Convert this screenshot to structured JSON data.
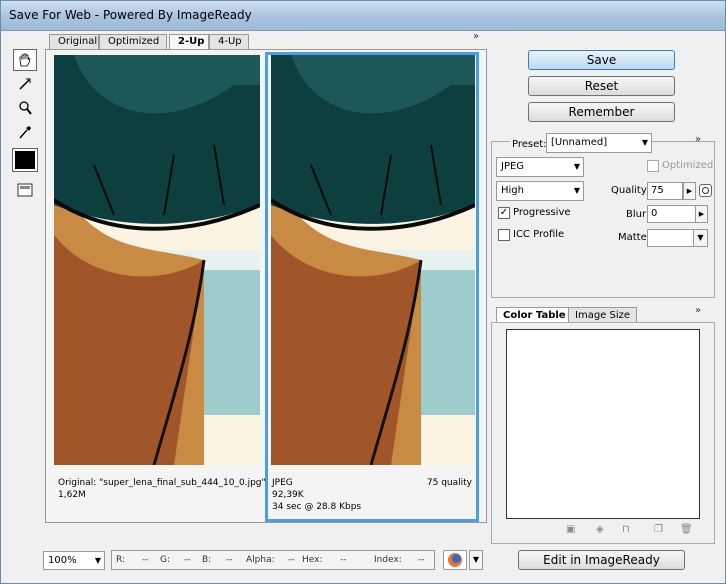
{
  "window": {
    "title": "Save For Web - Powered By ImageReady"
  },
  "tabs": [
    {
      "label": "Original"
    },
    {
      "label": "Optimized"
    },
    {
      "label": "2-Up"
    },
    {
      "label": "4-Up"
    }
  ],
  "original_pane": {
    "caption": "Original: \"super_lena_final_sub_444_10_0.jpg\"",
    "size": "1,62M"
  },
  "optimized_pane": {
    "format": "JPEG",
    "size": "92,39K",
    "download": "34 sec @ 28.8 Kbps",
    "quality": "75 quality"
  },
  "buttons": {
    "save": "Save",
    "reset": "Reset",
    "remember": "Remember",
    "edit": "Edit in ImageReady"
  },
  "settings": {
    "preset_label": "Preset:",
    "preset_value": "[Unnamed]",
    "format": "JPEG",
    "optimized_label": "Optimized",
    "quality_level": "High",
    "quality_label": "Quality:",
    "quality_value": "75",
    "progressive_label": "Progressive",
    "blur_label": "Blur:",
    "blur_value": "0",
    "icc_label": "ICC Profile",
    "matte_label": "Matte:"
  },
  "color_tabs": [
    {
      "label": "Color Table"
    },
    {
      "label": "Image Size"
    }
  ],
  "status_bar": {
    "zoom": "100%",
    "r": "R:",
    "r_val": "--",
    "g": "G:",
    "g_val": "--",
    "b": "B:",
    "b_val": "--",
    "alpha": "Alpha:",
    "alpha_val": "--",
    "hex": "Hex:",
    "hex_val": "--",
    "index": "Index:",
    "index_val": "--"
  },
  "icons": [
    "hand-icon",
    "slice-select-icon",
    "zoom-icon",
    "eyedropper-icon",
    "eyedropper-color-icon",
    "toggle-slices-icon",
    "browser-preview-icon"
  ],
  "colors": {
    "accent": "#4a9ee8",
    "skin": "#c98a43",
    "shorts": "#0e3f3f",
    "sea": "#9ccccc",
    "sand": "#fbf4e3"
  }
}
